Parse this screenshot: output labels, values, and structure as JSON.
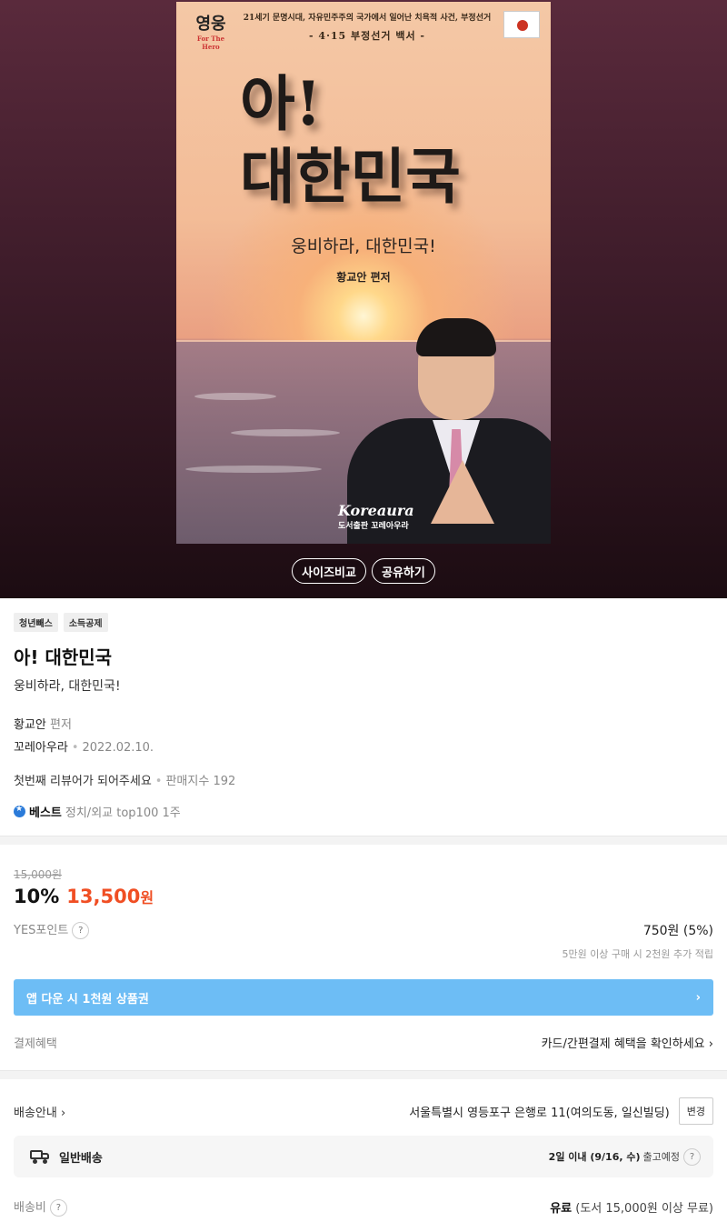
{
  "cover": {
    "publisher_logo": "영웅",
    "publisher_logo_sub": "For The Hero",
    "top_line": "21세기 문명시대, 자유민주주의 국가에서 일어난 치욕적 사건, 부정선거",
    "top_sub": "- 4·15 부정선거 백서 -",
    "title_line1": "아!",
    "title_line2": "대한민국",
    "subtitle": "웅비하라, 대한민국!",
    "author": "황교안 편저",
    "brand": "Koreaura",
    "brand_sub": "도서출판 꼬레아우라"
  },
  "hero_buttons": {
    "size_compare": "사이즈비교",
    "share": "공유하기"
  },
  "badges": [
    "청년빼스",
    "소득공제"
  ],
  "book": {
    "title": "아! 대한민국",
    "subtitle": "웅비하라, 대한민국!",
    "author": "황교안",
    "author_role": "편저",
    "publisher": "꼬레아우라",
    "date": "2022.02.10."
  },
  "review": {
    "text": "첫번째 리뷰어가 되어주세요",
    "sales_label": "판매지수 192"
  },
  "best": {
    "label": "베스트",
    "category": "정치/외교 top100 1주"
  },
  "price": {
    "original": "15,000원",
    "discount": "10%",
    "sale": "13,500",
    "won": "원",
    "points_label": "YES포인트",
    "points_value": "750원 (5%)",
    "points_note": "5만원 이상 구매 시 2천원 추가 적립"
  },
  "banner": {
    "text": "앱 다운 시 1천원 상품권"
  },
  "benefit": {
    "label": "결제혜택",
    "link": "카드/간편결제 혜택을 확인하세요"
  },
  "shipping": {
    "label": "배송안내",
    "address": "서울특별시 영등포구 은행로 11(여의도동, 일신빌딩)",
    "change": "변경",
    "type": "일반배송",
    "eta_bold": "2일 이내 (9/16, 수)",
    "eta_rest": "출고예정",
    "fee_label": "배송비",
    "fee_bold": "유료",
    "fee_rest": "(도서 15,000원 이상 무료)"
  },
  "icons": {
    "question": "question-icon",
    "chevron": "chevron-right-icon",
    "truck": "truck-icon",
    "best": "best-ribbon-icon"
  }
}
